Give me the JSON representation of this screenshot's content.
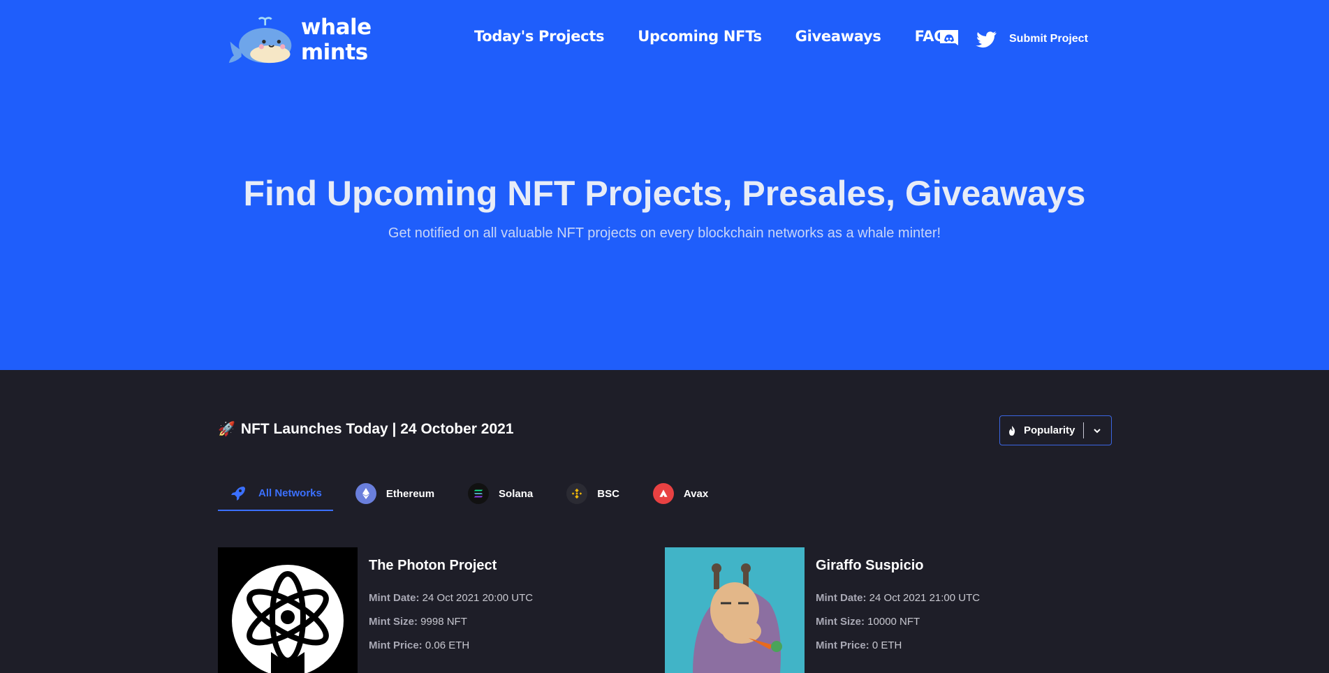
{
  "nav": {
    "logo_text": "whale mints",
    "links": [
      "Today's Projects",
      "Upcoming NFTs",
      "Giveaways",
      "FAQ"
    ],
    "submit_label": "Submit Project"
  },
  "hero": {
    "title": "Find Upcoming NFT Projects, Presales, Giveaways",
    "subtitle": "Get notified on all valuable NFT projects on every blockchain networks as a whale minter!"
  },
  "launches": {
    "title": "NFT Launches Today | 24 October 2021",
    "sort_label": "Popularity"
  },
  "tabs": [
    {
      "label": "All Networks",
      "icon": "rocket-icon",
      "active": true
    },
    {
      "label": "Ethereum",
      "icon": "ethereum-icon",
      "active": false
    },
    {
      "label": "Solana",
      "icon": "solana-icon",
      "active": false
    },
    {
      "label": "BSC",
      "icon": "bsc-icon",
      "active": false
    },
    {
      "label": "Avax",
      "icon": "avax-icon",
      "active": false
    }
  ],
  "projects": [
    {
      "name": "The Photon Project",
      "mint_date_label": "Mint Date:",
      "mint_date": "24 Oct 2021 20:00 UTC",
      "mint_size_label": "Mint Size:",
      "mint_size": "9998 NFT",
      "mint_price_label": "Mint Price:",
      "mint_price": "0.06 ETH"
    },
    {
      "name": "Giraffo Suspicio",
      "mint_date_label": "Mint Date:",
      "mint_date": "24 Oct 2021 21:00 UTC",
      "mint_size_label": "Mint Size:",
      "mint_size": "10000 NFT",
      "mint_price_label": "Mint Price:",
      "mint_price": "0 ETH"
    }
  ],
  "colors": {
    "hero_bg": "#1f5efb",
    "section_bg": "#1e1e28",
    "accent": "#3b70ff"
  }
}
